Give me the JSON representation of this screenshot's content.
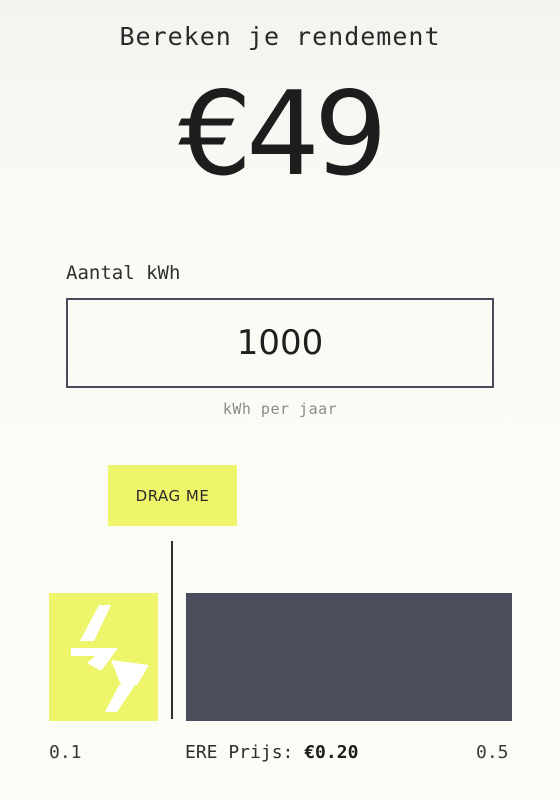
{
  "header": {
    "title": "Bereken je rendement",
    "amount": "€49"
  },
  "kwh": {
    "label": "Aantal kWh",
    "value": "1000",
    "unit_caption": "kWh per jaar"
  },
  "slider": {
    "handle_label": "DRAG ME",
    "min_label": "0.1",
    "max_label": "0.5",
    "price_label": "ERE Prijs:",
    "price_value": "€0.20",
    "current_value": 0.2,
    "min": 0.1,
    "max": 0.5
  },
  "colors": {
    "accent": "#eef56a",
    "bar": "#4a4e5c",
    "background": "#fcfcf6",
    "text": "#1f1f1f"
  },
  "icons": {
    "bolt": "lightning-bolt-icon"
  }
}
